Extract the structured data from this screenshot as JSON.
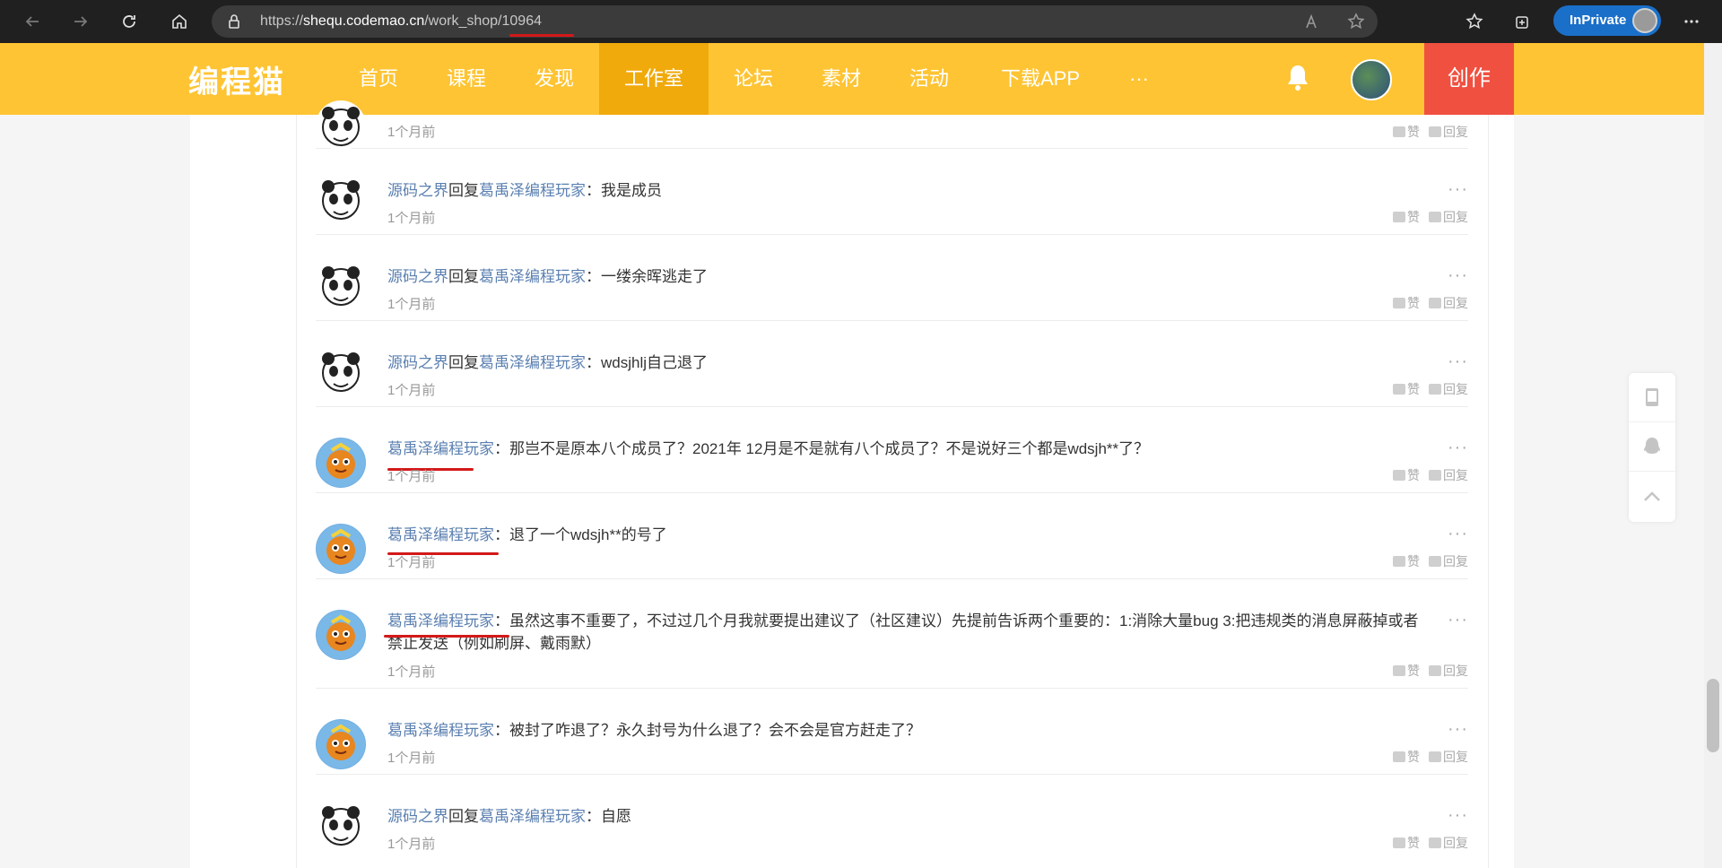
{
  "browser": {
    "url_scheme": "https://",
    "url_host": "shequ.codemao.cn",
    "url_path": "/work_shop/10964",
    "inprivate_label": "InPrivate"
  },
  "header": {
    "logo": "编程猫",
    "nav": [
      "首页",
      "课程",
      "发现",
      "工作室",
      "论坛",
      "素材",
      "活动",
      "下载APP",
      "···"
    ],
    "active_nav": "工作室",
    "create_label": "创作",
    "colors": {
      "header_bg": "#fec433",
      "active_bg": "#f0aa0c",
      "create_bg": "#f05040",
      "link": "#5a7fb0"
    }
  },
  "comments": [
    {
      "avatar": "panda-avatar",
      "author": "",
      "reply_word": "",
      "target": "",
      "text": "",
      "time": "1个月前"
    },
    {
      "avatar": "panda-avatar",
      "author": "源码之界",
      "reply_word": "回复",
      "target": "葛禹泽编程玩家",
      "text": "：我是成员",
      "time": "1个月前"
    },
    {
      "avatar": "panda-avatar",
      "author": "源码之界",
      "reply_word": "回复",
      "target": "葛禹泽编程玩家",
      "text": "：一缕余晖逃走了",
      "time": "1个月前"
    },
    {
      "avatar": "panda-avatar",
      "author": "源码之界",
      "reply_word": "回复",
      "target": "葛禹泽编程玩家",
      "text": "：wdsjhlj自己退了",
      "time": "1个月前"
    },
    {
      "avatar": "monkey-avatar",
      "author": "葛禹泽编程玩家",
      "reply_word": "",
      "target": "",
      "text": "：那岂不是原本八个成员了？2021年 12月是不是就有八个成员了？不是说好三个都是wdsjh**了？",
      "time": "1个月前"
    },
    {
      "avatar": "monkey-avatar",
      "author": "葛禹泽编程玩家",
      "reply_word": "",
      "target": "",
      "text": "：退了一个wdsjh**的号了",
      "time": "1个月前"
    },
    {
      "avatar": "monkey-avatar",
      "author": "葛禹泽编程玩家",
      "reply_word": "",
      "target": "",
      "text": "：虽然这事不重要了，不过过几个月我就要提出建议了（社区建议）先提前告诉两个重要的：1:消除大量bug 3:把违规类的消息屏蔽掉或者禁止发送（例如刷屏、戴雨默）",
      "time": "1个月前"
    },
    {
      "avatar": "monkey-avatar",
      "author": "葛禹泽编程玩家",
      "reply_word": "",
      "target": "",
      "text": "：被封了咋退了？永久封号为什么退了？会不会是官方赶走了？",
      "time": "1个月前"
    },
    {
      "avatar": "panda-avatar",
      "author": "源码之界",
      "reply_word": "回复",
      "target": "葛禹泽编程玩家",
      "text": "：自愿",
      "time": "1个月前"
    }
  ],
  "actions": {
    "like": "赞",
    "reply": "回复",
    "more": "···"
  }
}
